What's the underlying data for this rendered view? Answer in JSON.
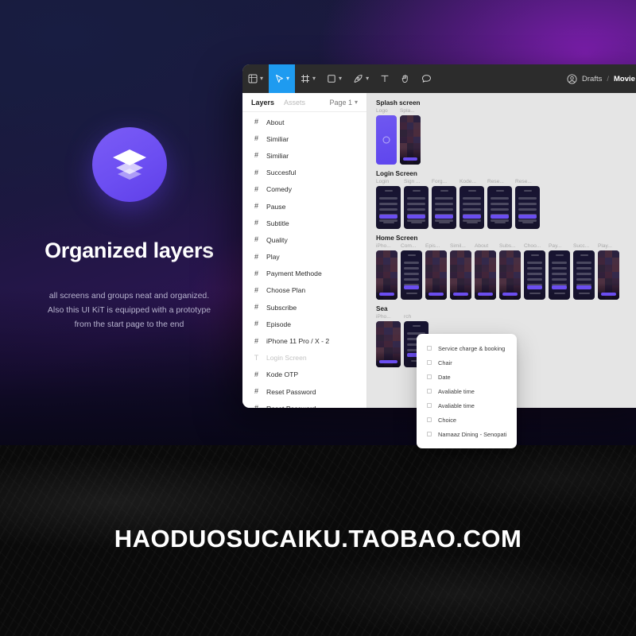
{
  "promo": {
    "logo_icon": "layers-stack-icon",
    "title": "Organized layers",
    "lines": [
      "all screens and groups neat and organized.",
      "Also this UI KiT is equipped with a prototype",
      "from the start page to the end"
    ],
    "accent_color": "#6c4ef2"
  },
  "watermark": {
    "text": "HAODUOSUCAIKU.TAOBAO.COM"
  },
  "figma": {
    "toolbar": {
      "active_color": "#1e9bf0",
      "tools": [
        {
          "name": "figma-menu-icon",
          "glyph": "menu",
          "chevron": true,
          "active": false
        },
        {
          "name": "move-cursor-icon",
          "glyph": "cursor",
          "chevron": true,
          "active": true
        },
        {
          "name": "frame-icon",
          "glyph": "frame",
          "chevron": true,
          "active": false
        },
        {
          "name": "shape-icon",
          "glyph": "square",
          "chevron": true,
          "active": false
        },
        {
          "name": "pen-icon",
          "glyph": "pen",
          "chevron": true,
          "active": false
        },
        {
          "name": "text-icon",
          "glyph": "T",
          "chevron": false,
          "active": false
        },
        {
          "name": "hand-icon",
          "glyph": "hand",
          "chevron": false,
          "active": false
        },
        {
          "name": "comment-icon",
          "glyph": "comment",
          "chevron": false,
          "active": false
        }
      ]
    },
    "breadcrumb": {
      "avatar_icon": "user-avatar-icon",
      "parent": "Drafts",
      "separator": "/",
      "current": "Movie stre"
    },
    "panel": {
      "tab_layers": "Layers",
      "tab_assets": "Assets",
      "page": "Page 1",
      "page_chevron": "⌄",
      "layers": [
        {
          "label": "About",
          "icon": "component-icon",
          "dim": false
        },
        {
          "label": "Similiar",
          "icon": "component-icon",
          "dim": false
        },
        {
          "label": "Similiar",
          "icon": "component-icon",
          "dim": false
        },
        {
          "label": "Succesful",
          "icon": "component-icon",
          "dim": false
        },
        {
          "label": "Comedy",
          "icon": "component-icon",
          "dim": false
        },
        {
          "label": "Pause",
          "icon": "component-icon",
          "dim": false
        },
        {
          "label": "Subtitle",
          "icon": "component-icon",
          "dim": false
        },
        {
          "label": "Quality",
          "icon": "component-icon",
          "dim": false
        },
        {
          "label": "Play",
          "icon": "component-icon",
          "dim": false
        },
        {
          "label": "Payment Methode",
          "icon": "component-icon",
          "dim": false
        },
        {
          "label": "Choose Plan",
          "icon": "component-icon",
          "dim": false
        },
        {
          "label": "Subscribe",
          "icon": "component-icon",
          "dim": false
        },
        {
          "label": "Episode",
          "icon": "component-icon",
          "dim": false
        },
        {
          "label": "iPhone 11 Pro / X - 2",
          "icon": "component-icon",
          "dim": false
        },
        {
          "label": "Login Screen",
          "icon": "text-layer-icon",
          "dim": true
        },
        {
          "label": "Kode OTP",
          "icon": "component-icon",
          "dim": false
        },
        {
          "label": "Reset Password",
          "icon": "component-icon",
          "dim": false
        },
        {
          "label": "Reset Password",
          "icon": "component-icon",
          "dim": false
        }
      ]
    },
    "canvas": {
      "sections": [
        {
          "title": "Splash screen",
          "frames": [
            {
              "label": "Logo",
              "style": "p-splash1"
            },
            {
              "label": "Spla...",
              "style": "p-poster"
            }
          ]
        },
        {
          "title": "Login Screen",
          "frames": [
            {
              "label": "Login",
              "style": "p-dark"
            },
            {
              "label": "Sign ...",
              "style": "p-dark"
            },
            {
              "label": "Forg...",
              "style": "p-dark"
            },
            {
              "label": "Kode...",
              "style": "p-dark"
            },
            {
              "label": "Rese...",
              "style": "p-dark"
            },
            {
              "label": "Rese...",
              "style": "p-dark"
            }
          ]
        },
        {
          "title": "Home Screen",
          "frames": [
            {
              "label": "iPho...",
              "style": "p-poster"
            },
            {
              "label": "Com...",
              "style": "p-dark"
            },
            {
              "label": "Epis...",
              "style": "p-poster"
            },
            {
              "label": "Simil...",
              "style": "p-poster"
            },
            {
              "label": "About",
              "style": "p-poster"
            },
            {
              "label": "Subs...",
              "style": "p-poster"
            },
            {
              "label": "Choo...",
              "style": "p-dark"
            },
            {
              "label": "Pay...",
              "style": "p-dark"
            },
            {
              "label": "Succ...",
              "style": "p-dark"
            },
            {
              "label": "Play...",
              "style": "p-poster"
            }
          ]
        },
        {
          "title": "Sea",
          "frames": [
            {
              "label": "iPho...",
              "style": "p-poster"
            },
            {
              "label": "rch",
              "style": "p-dark"
            }
          ]
        }
      ]
    },
    "dropdown": {
      "items": [
        "Service charge & booking",
        "Chair",
        "Date",
        "Avaliable time",
        "Avaliable time",
        "Choice",
        "Namaaz Dining - Senopati"
      ]
    }
  }
}
